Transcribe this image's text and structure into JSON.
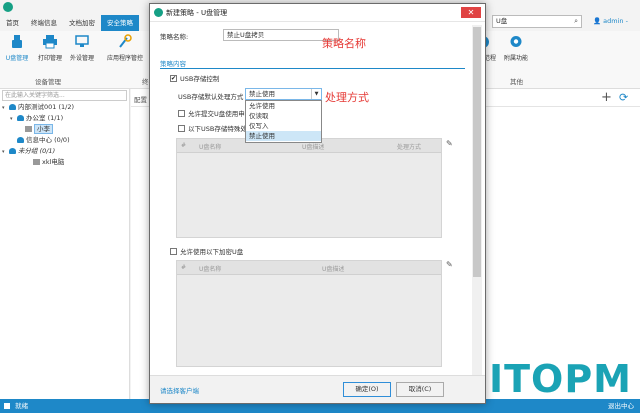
{
  "app": {
    "tabs": [
      "首页",
      "终端信息",
      "文档加密",
      "安全策略"
    ],
    "active_tab": "安全策略",
    "ribbon": {
      "buttons": [
        "U盘管理",
        "打印管理",
        "外设管理",
        "应用程序管控"
      ],
      "right_buttons": [
        "范程",
        "附属功能"
      ],
      "group_labels": [
        "设备管理",
        "其他"
      ],
      "partial_label": "终"
    },
    "search_value": "U盘",
    "user": "admin -",
    "sidebar": {
      "search_placeholder": "在此输入关键字筛选...",
      "tree": [
        {
          "label": "内部测试001 (1/2)",
          "level": 0,
          "toggle": "▾"
        },
        {
          "label": "办公室 (1/1)",
          "level": 1,
          "toggle": "▾"
        },
        {
          "label": "小李",
          "level": 2,
          "toggle": ""
        },
        {
          "label": "信息中心 (0/0)",
          "level": 1,
          "toggle": ""
        },
        {
          "label": "未分组 (0/1)",
          "level": 0,
          "toggle": "▾"
        },
        {
          "label": "xkl电脑",
          "level": 1,
          "toggle": ""
        }
      ],
      "selected_index": 2
    },
    "right_header_label": "配置",
    "status": "就绪",
    "status_right": "退出中心",
    "colors": {
      "accent": "#1e88c8",
      "brand": "#16a085",
      "annotation": "#e53935"
    }
  },
  "dialog": {
    "title": "新建策略 - U盘管理",
    "close_glyph": "✕",
    "policy_name_label": "策略名称:",
    "policy_name_value": "禁止U盘拷贝",
    "annotation_name": "策略名称",
    "section_title": "策略内容",
    "usb_control_label": "USB存储控制",
    "usb_control_checked": true,
    "default_mode_label": "USB存储默认处理方式",
    "default_mode_value": "禁止使用",
    "annotation_mode": "处理方式",
    "mode_options": [
      "允许使用",
      "仅读取",
      "仅写入",
      "禁止使用"
    ],
    "mode_selected_index": 3,
    "allow_submit_label": "允许提交U盘使用申",
    "special_usb_label": "以下USB存储特殊处",
    "grid1_headers": [
      "#",
      "U盘名称",
      "U盘描述",
      "处理方式"
    ],
    "allow_encrypted_label": "允许使用以下加密U盘",
    "grid2_headers": [
      "#",
      "U盘名称",
      "U盘描述"
    ],
    "footer_link": "请选择客户端",
    "ok_label": "确定(O)",
    "cancel_label": "取消(C)"
  },
  "watermark": "ITOPM"
}
